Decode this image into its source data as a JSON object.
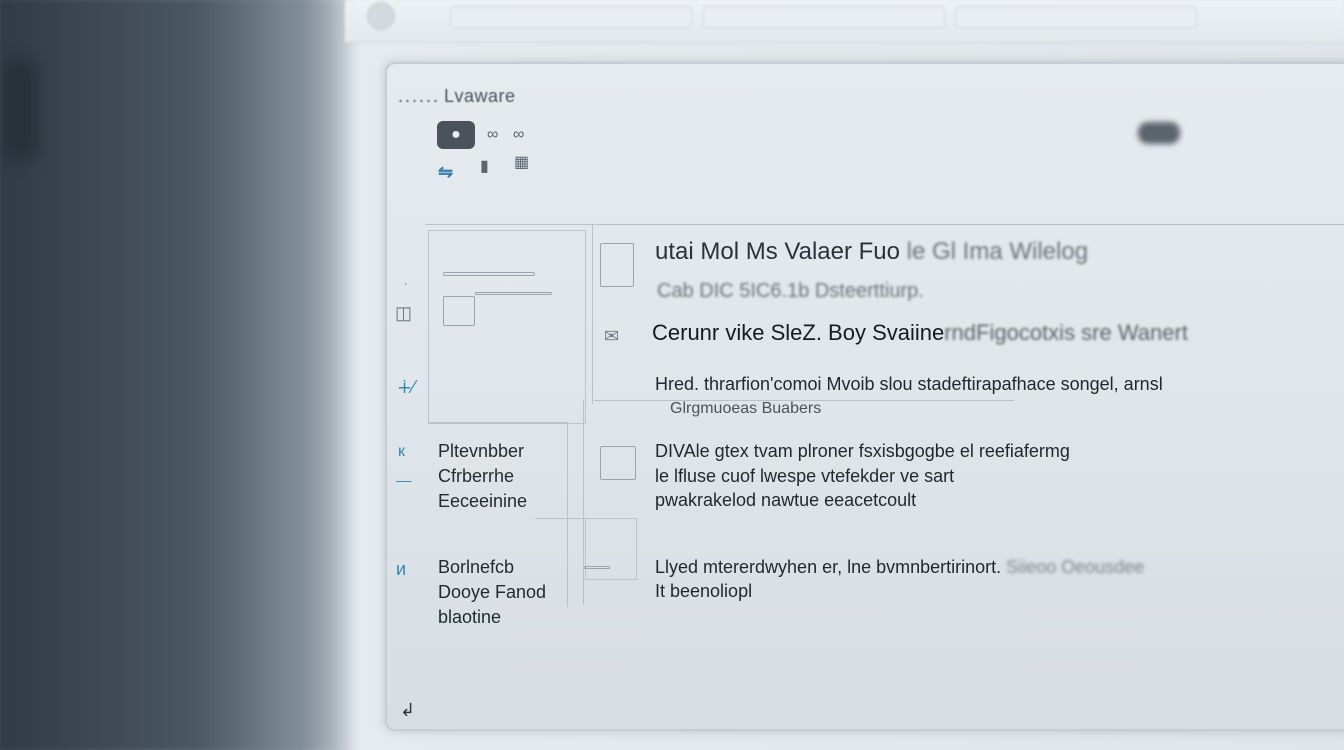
{
  "window": {
    "title": "Lvaware",
    "title_prefix": "......"
  },
  "toolbar": {
    "user_icon": "person-icon",
    "icons": [
      "glasses-icon",
      "link-icon",
      "bar-icon",
      "lock-icon"
    ]
  },
  "sidebar": {
    "preview_label": "",
    "items": [
      {
        "icon": "hash-icon",
        "lines": []
      },
      {
        "icon": "k-icon",
        "lines": [
          "Pltevnbber",
          "Cfrberrhe",
          "Eeceeinine"
        ]
      },
      {
        "icon": "nk-icon",
        "lines": [
          "Borlnefcb",
          "Dooye Fanod",
          "blaotine"
        ]
      }
    ]
  },
  "content": {
    "heading": "utai Mol Ms Valaer Fuo",
    "heading_faded": "le Gl Ima Wilelog",
    "subheading": "Cab DIC 5IC6.1b Dsteerttiurp.",
    "item1": {
      "title": "Cerunr vike SleZ. Boy Svaiine",
      "title_faded": "rndFigocotxis sre Wanert",
      "line1": "Hred. thrarfion'comoi Mvoib slou stadeftirapafhace songel, arnsl",
      "line2": "Glrgmuoeas Buabers"
    },
    "item2": {
      "line1": "DIVAle gtex tvam plroner fsxisbgogbe el reefiafermg",
      "line2": "le lfluse cuof lwespe vtefekder ve sart",
      "line3": "pwakrakelod nawtue eeacetcoult"
    },
    "item3": {
      "line1": "Llyed mtererdwyhen er, lne bvmnbertirinort.",
      "line1_faded": "Siieoo Oeousdee",
      "line2": "It beenoliopl"
    }
  },
  "colors": {
    "accent": "#2f8bb4",
    "text": "#1f2a33",
    "panel": "#e3e8ec"
  }
}
